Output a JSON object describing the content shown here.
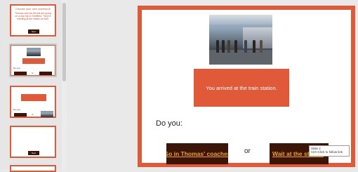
{
  "thumbnails": [
    {
      "title": "Choose your own adventure",
      "body": "Thomas and his friends are going on a day trip to Sheffield. They're meeting at the station at 9am.",
      "button": "Next"
    },
    {
      "prompt": "Do you:",
      "left_choice": "Go in Thomas' coaches",
      "or": "or",
      "right_choice": "Wait at the station"
    },
    {
      "prompt": "Do you:",
      "left_choice": "Go in Thomas' coaches",
      "or": "or",
      "right_choice": "Wait at the station"
    },
    {
      "button": "Next"
    }
  ],
  "slide": {
    "arrival_text": "You arrived at the train station.",
    "question": "Do you:",
    "left_choice": "Go in Thomas' coaches",
    "or_text": "or",
    "right_choice": "Wait at the station"
  },
  "tooltip": {
    "line1": "Slide 2",
    "line2": "Ctrl+Click to follow link"
  },
  "colors": {
    "accent": "#e05a3a",
    "button_bg": "#3b1508",
    "link_text": "#f1a020"
  }
}
